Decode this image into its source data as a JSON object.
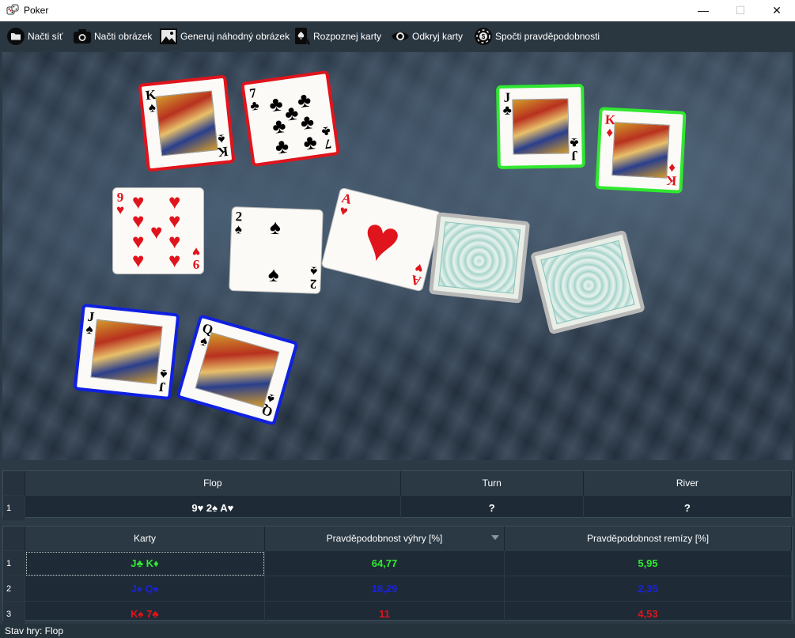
{
  "window": {
    "title": "Poker",
    "minimize_glyph": "—",
    "maximize_glyph": "☐",
    "close_glyph": "✕"
  },
  "toolbar": {
    "load_network": "Načti síť",
    "load_image": "Načti obrázek",
    "generate_random": "Generuj náhodný obrázek",
    "recognize_cards": "Rozpoznej karty",
    "reveal_cards": "Odkryj karty",
    "compute_probabilities": "Spočti pravděpodobnosti"
  },
  "photo_cards": {
    "k_spades": {
      "rank": "K",
      "suit": "♠",
      "color": "#000000"
    },
    "seven_clubs": {
      "rank": "7",
      "suit": "♣",
      "color": "#000000"
    },
    "j_clubs": {
      "rank": "J",
      "suit": "♣",
      "color": "#000000"
    },
    "k_diamonds": {
      "rank": "K",
      "suit": "♦",
      "color": "#e0141c"
    },
    "nine_hearts": {
      "rank": "9",
      "suit": "♥",
      "color": "#e0141c"
    },
    "two_spades": {
      "rank": "2",
      "suit": "♠",
      "color": "#000000"
    },
    "ace_hearts": {
      "rank": "A",
      "suit": "♥",
      "color": "#e0141c"
    },
    "j_spades": {
      "rank": "J",
      "suit": "♠",
      "color": "#000000"
    },
    "q_spades": {
      "rank": "Q",
      "suit": "♠",
      "color": "#000000"
    }
  },
  "board_table": {
    "headers": [
      "Flop",
      "Turn",
      "River"
    ],
    "rows": [
      {
        "num": "1",
        "flop": "9♥ 2♠ A♥",
        "turn": "?",
        "river": "?"
      }
    ]
  },
  "players_table": {
    "headers": [
      "Karty",
      "Pravděpodobnost výhry [%]",
      "Pravděpodobnost remízy [%]"
    ],
    "rows": [
      {
        "num": "1",
        "cards": "J♣ K♦",
        "win": "64,77",
        "tie": "5,95",
        "color": "#30e830"
      },
      {
        "num": "2",
        "cards": "J♠ Q♠",
        "win": "18,29",
        "tie": "2,35",
        "color": "#1a22d8"
      },
      {
        "num": "3",
        "cards": "K♠ 7♣",
        "win": "11",
        "tie": "4,53",
        "color": "#e0141c"
      }
    ]
  },
  "status": {
    "text": "Stav hry: Flop"
  }
}
